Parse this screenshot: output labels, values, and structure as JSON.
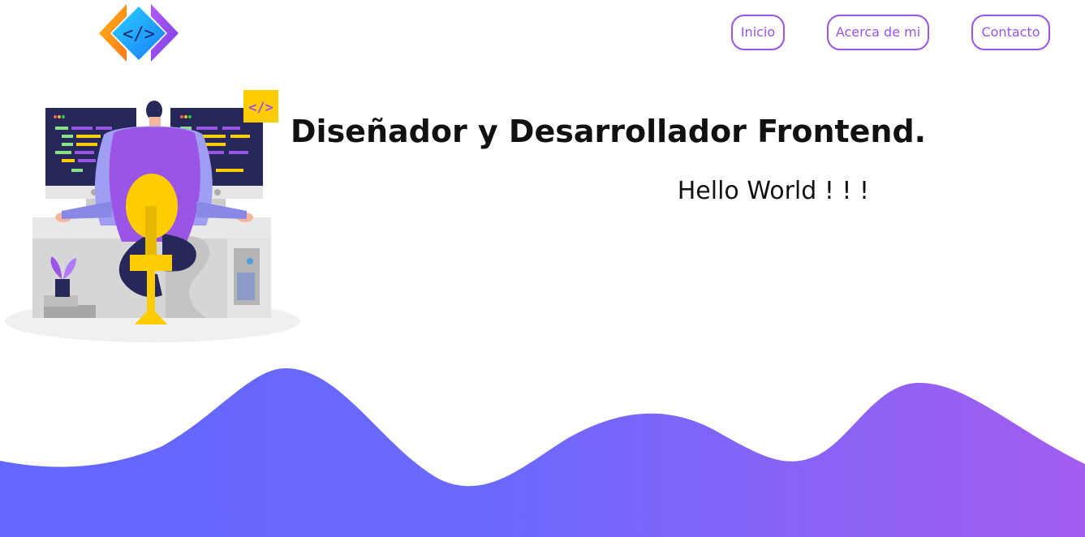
{
  "header": {
    "logo_icon": "code-brackets-logo",
    "nav": [
      {
        "label": "Inicio"
      },
      {
        "label": "Acerca de mi"
      },
      {
        "label": "Contacto"
      }
    ]
  },
  "hero": {
    "title": "Diseñador y Desarrollador Frontend.",
    "subtitle": "Hello World ! ! !",
    "illustration_icon": "developer-at-desk-illustration",
    "badge_text": "</>"
  },
  "colors": {
    "accent": "#9a55e6",
    "wave_start": "#6366ff",
    "wave_end": "#a35ef0",
    "yellow": "#ffcc00",
    "monitor": "#26285a"
  }
}
